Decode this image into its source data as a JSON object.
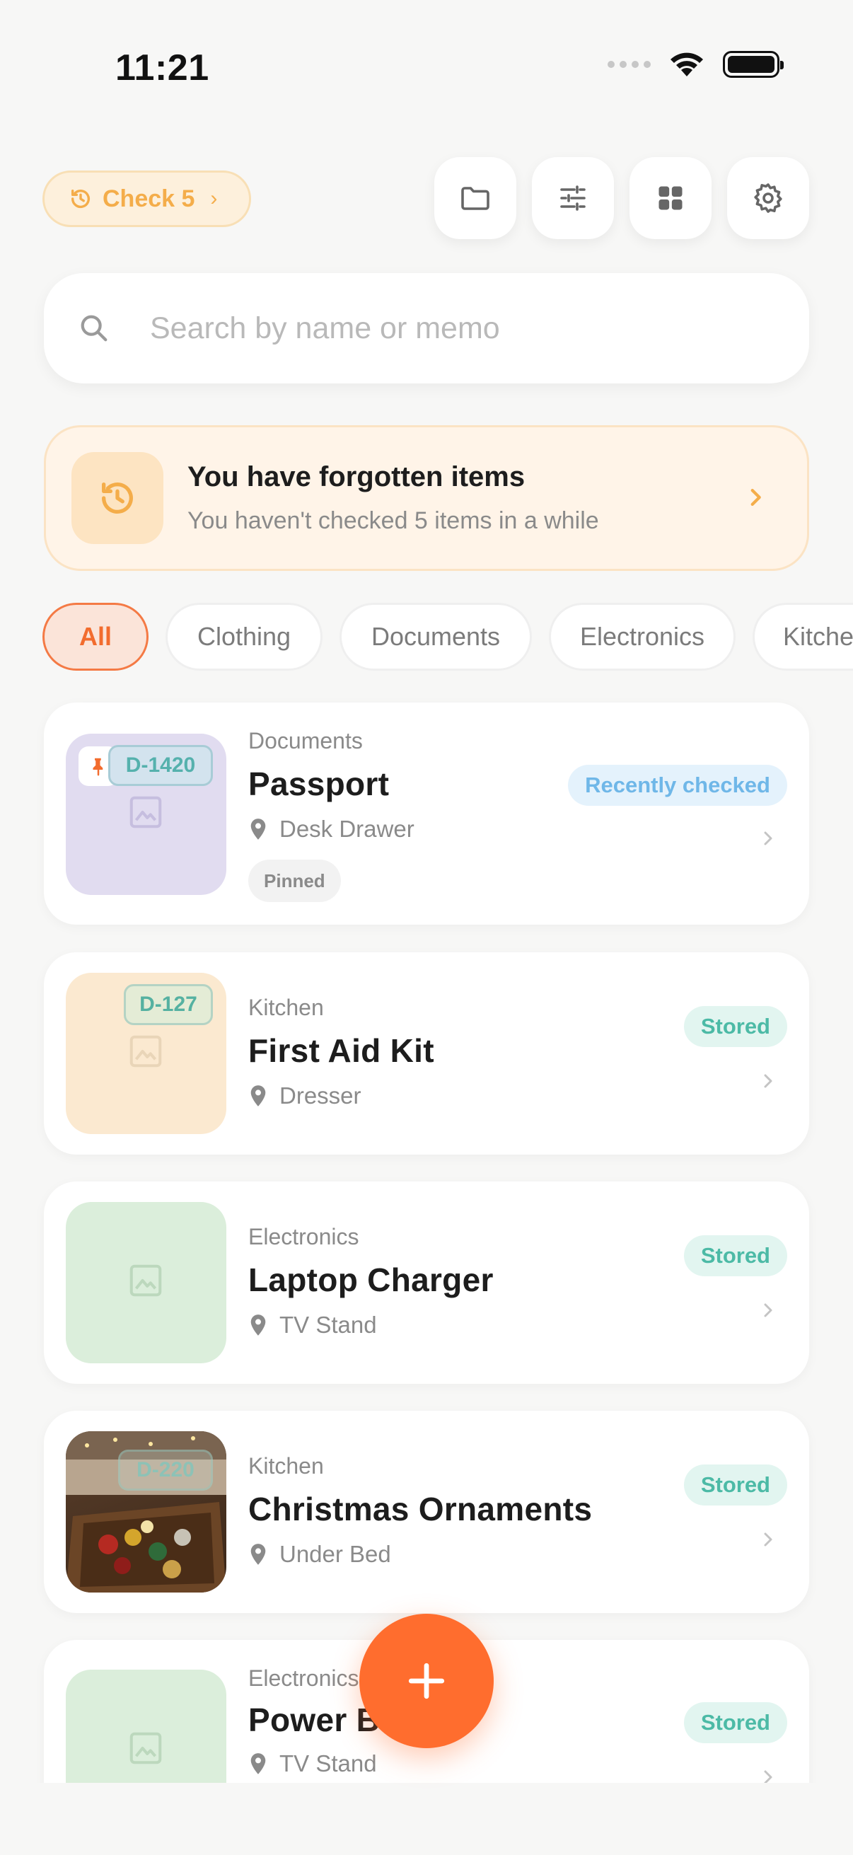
{
  "status_bar": {
    "time": "11:21"
  },
  "toolbar": {
    "check_label": "Check 5",
    "buttons": [
      "folder-icon",
      "sliders-icon",
      "grid-icon",
      "gear-icon"
    ]
  },
  "search": {
    "placeholder": "Search by name or memo",
    "value": ""
  },
  "banner": {
    "title": "You have forgotten items",
    "subtitle": "You haven't checked 5 items in a while"
  },
  "categories": [
    "All",
    "Clothing",
    "Documents",
    "Electronics",
    "Kitchen"
  ],
  "items": [
    {
      "category": "Documents",
      "name": "Passport",
      "location": "Desk Drawer",
      "status": "Recently checked",
      "id_tag": "D-1420",
      "pinned_label": "Pinned",
      "thumb_color": "#e1dcf0"
    },
    {
      "category": "Kitchen",
      "name": "First Aid Kit",
      "location": "Dresser",
      "status": "Stored",
      "id_tag": "D-127",
      "thumb_color": "#fbe9d0"
    },
    {
      "category": "Electronics",
      "name": "Laptop Charger",
      "location": "TV Stand",
      "status": "Stored",
      "thumb_color": "#dbeedb"
    },
    {
      "category": "Kitchen",
      "name": "Christmas Ornaments",
      "location": "Under Bed",
      "status": "Stored",
      "id_tag": "D-220"
    },
    {
      "category": "Electronics",
      "name": "Power B",
      "location": "TV Stand",
      "status": "Stored",
      "thumb_color": "#dbeedb"
    }
  ],
  "colors": {
    "accent": "#ff6d2e",
    "stored": "#4cbaa6",
    "recent": "#6fb7e8",
    "warning": "#f4ad4a"
  }
}
